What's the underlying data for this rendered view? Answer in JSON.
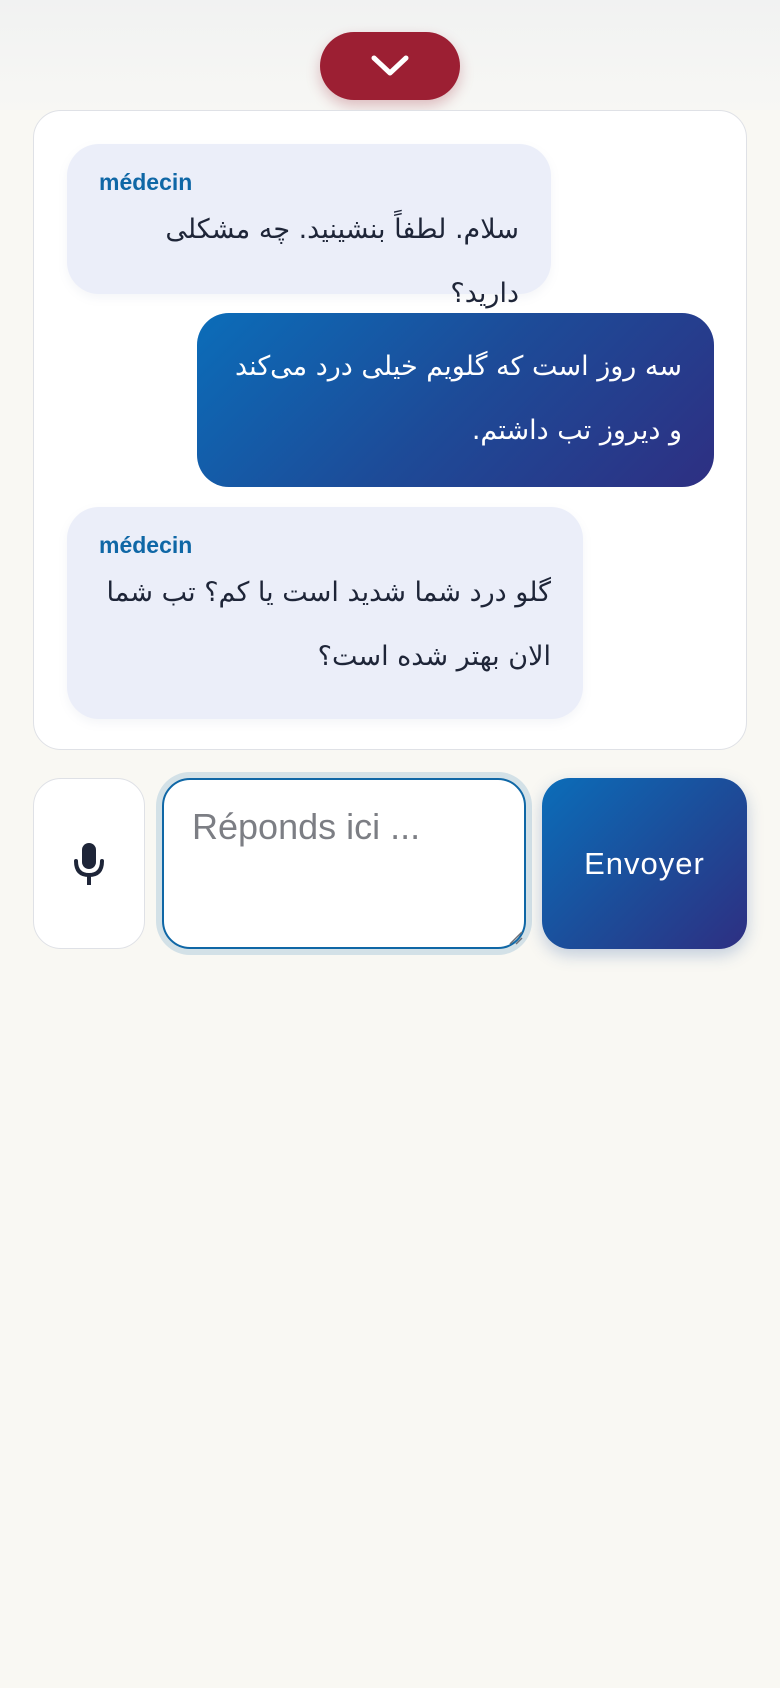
{
  "header": {
    "collapse_icon": "chevron-down-icon",
    "collapse_color": "#9c1f33"
  },
  "chat": {
    "messages": [
      {
        "role": "incoming",
        "sender": "médecin",
        "text": "سلام. لطفاً بنشینید. چه مشکلی دارید؟"
      },
      {
        "role": "outgoing",
        "text": "سه روز است که گلویم خیلی درد می‌کند و دیروز تب داشتم."
      },
      {
        "role": "incoming",
        "sender": "médecin",
        "text": "گلو درد شما شدید است یا کم؟ تب شما الان بهتر شده است؟"
      }
    ]
  },
  "composer": {
    "mic_icon": "microphone-icon",
    "input_placeholder": "Réponds ici ...",
    "input_value": "",
    "send_label": "Envoyer"
  },
  "colors": {
    "accent_blue": "#0f67a6",
    "accent_red": "#9c1f33",
    "incoming_bubble": "#ebeef9",
    "outgoing_gradient": [
      "#0b6db9",
      "#2e2f82"
    ]
  }
}
